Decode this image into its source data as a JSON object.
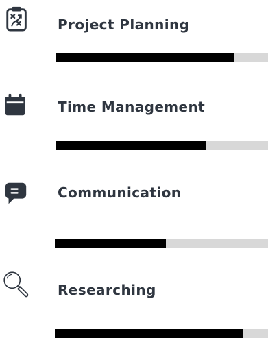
{
  "colors": {
    "text": "#2f3640",
    "icon": "#2f3640",
    "bar_fill": "#000000",
    "bar_track": "#d8d8d8"
  },
  "skills": [
    {
      "icon": "clipboard-strategy-icon",
      "label": "Project Planning",
      "level": 0.84
    },
    {
      "icon": "calendar-icon",
      "label": "Time Management",
      "level": 0.71
    },
    {
      "icon": "chat-bubble-icon",
      "label": "Communication",
      "level": 0.52
    },
    {
      "icon": "magnifier-icon",
      "label": "Researching",
      "level": 0.88
    }
  ]
}
